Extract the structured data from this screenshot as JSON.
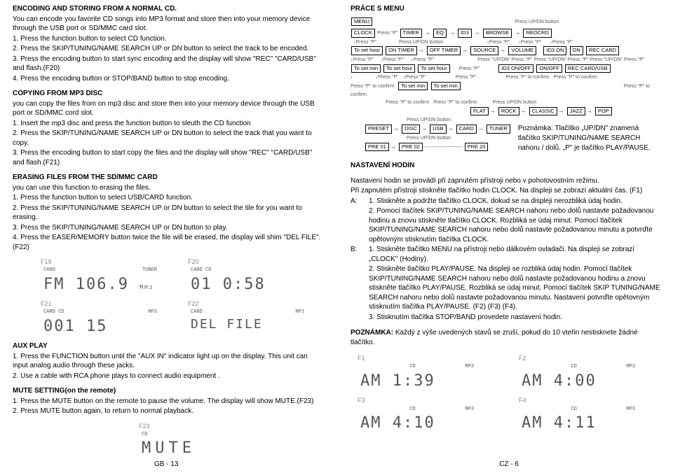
{
  "left": {
    "h1": "ENCODING AND STORING FROM A NORMAL CD.",
    "p1a": "You can encode you favorite CD songs into MP3 format and store then into your memory device through the USB port or SD/MMC card slot.",
    "p1b": "1. Press the function button to select CD function.",
    "p1c": "2. Press the SKIP/TUNING/NAME SEARCH UP or DN button to select the track to be encoded.",
    "p1d": "3. Press the encoding button to start sync encoding and the display will show \"REC\" \"CARD/USB\" and flash.(F20)",
    "p1e": "4. Press the encoding button or STOP/BAND button to stop encoding.",
    "h2": "COPYING FROM MP3 DISC",
    "p2a": "you can copy the files from on mp3 disc and store then into your memory device through the USB port or SD/MMC cord slot.",
    "p2b": "1. Insert the mp3 disc and press the function button to sleuth the CD function",
    "p2c": "2. Press the SKIP/TUNING/NAME SEARCH UP or DN button to select the track that you want to copy.",
    "p2d": "3. Press the encoding button to start copy the files and the display will show \"REC\" \"CARD/USB\" and flash.(F21)",
    "h3": "ERASING FILES FROM THE SD/MMC CARD",
    "p3a": "you can use this function to erasing the files.",
    "p3b": "1. Press the function button to select USB/CARD function.",
    "p3c": "2. Press the SKIP/TUNING/NAME SEARCH UP or DN button to select the tile for you want to erasing.",
    "p3d": "3. Press the SKIP/TUNING/NAME SEARCH UP or DN button to play.",
    "p3e": "4. Press the EASER/MEMORY button twice the file will be erased, the display will shim \"DEL FILE\".(F22)",
    "f19_label": "F19",
    "f20_label": "F20",
    "f21_label": "F21",
    "f22_label": "F22",
    "f23_label": "F23",
    "f19_top_l": "CARD",
    "f19_top_r": "TUNER",
    "f19_main_l": "FM",
    "f19_main_r": "106.9",
    "f19_unit": "MHz",
    "f20_top_l": "CARD  CD",
    "f20_main": "01   0:58",
    "f21_top_l": "CARD  CD",
    "f21_top_r": "MP3",
    "f21_main": "001      15",
    "f22_top_l": "CARD",
    "f22_top_r": "MP3",
    "f22_main": "DEL FILE",
    "h4": "AUX PLAY",
    "p4a": "1. Press the FUNCTION button until the \"AUX IN\" indicator light up on the display. This unit can input analog audio through these jacks.",
    "p4b": "2. Use a cable with RCA phone plays to connect audio equipment .",
    "h5": "MUTE SETTING(on the remote)",
    "p5a": "1. Press the MUTE button on the remote to pause the volume. The display will show MUTE.(F23)",
    "p5b": "2. Press MUTE button again, to return to normal playback.",
    "f23_top_l": "CD",
    "f23_main": "MUTE",
    "footer": "GB - 13"
  },
  "right": {
    "h1": "PRÁCE S MENU",
    "d": {
      "menu": "MENU",
      "clock": "CLOCK",
      "timer": "TIMER",
      "eq": "EQ",
      "id3": "ID3",
      "browse": "BROWSE",
      "reocrd": "REOCRD",
      "tosethour": "To set hour",
      "tosetmin": "To set min",
      "ontimer": "ON TIMER",
      "offtimer": "OFF TIMER",
      "source": "SOURCE",
      "volume": "VOLUME",
      "id3on": "ID3 ON",
      "on": "ON",
      "reccard": "REC CARD",
      "id3onoff": "ID3 ON/OFF",
      "onoff": "ON/OFF",
      "reccardusb": "REC CARD/USB",
      "flat": "FLAT",
      "rock": "ROCK",
      "classic": "CLASSIC",
      "jazz": "JAZZ",
      "pop": "POP",
      "preset": "PRESET",
      "disc": "DISC",
      "usb": "USB",
      "card": "CARD",
      "tuner": "TUNER",
      "pre01": "PRE 01",
      "pre02": "PRE 02",
      "pre20": "PRE 20",
      "pressp": "Press \"P\"",
      "pressupdn": "Press UP/DN button",
      "pressptoconfirm": "Press \"P\" to confirm",
      "pressupdnpressp": "Press \"UP/DN\" Press \"P\""
    },
    "note1": "Poznámka: Tlačítko „UP/DN\" znamená tlačítko SKIP/TUNING/NAME SEARCH nahoru / dolů. „P\" je tlačítko PLAY/PAUSE.",
    "h2": "NASTAVENÍ HODIN",
    "p2a": "Nastavení hodin se provádí při zapnutém přístroji nebo v pohotovostním režimu.",
    "p2b": "Při zapnutém přístroji stiskněte tlačítko hodin CLOCK. Na displeji se zobrazí aktuální čas. (F1)",
    "pA_lbl": "A:",
    "pA1": "1. Stiskněte a podržte tlačítko CLOCK, dokud se na displeji nerozbliká údaj hodin.",
    "pA2": "2. Pomocí tlačítek SKIP/TUNING/NAME SEARCH nahoru nebo dolů nastavte požadovanou hodinu a znovu stiskněte tlačítko CLOCK. Rozbliká se údaj minut. Pomocí tlačítek SKIP/TUNING/NAME SEARCH nahoru nebo dolů nastavte požadovanou minutu a potvrďte opětovným stisknutím tlačítka CLOCK.",
    "pB_lbl": "B:",
    "pB1": "1. Stiskněte tlačítko MENU na přístroji nebo dálkovém ovladači. Na displeji se zobrazí „CLOCK\" (Hodiny).",
    "pB2": "2. Stiskněte tlačítko PLAY/PAUSE. Na displeji se rozbliká údaj hodin. Pomocí tlačítek SKIP/TUNING/NAME SEARCH nahoru nebo dolů nastavte požadovanou hodinu a znovu stiskněte tlačítko PLAY/PAUSE. Rozbliká se údaj minut. Pomocí tlačítek SKIP TUNING/NAME SEARCH nahoru nebo dolů nastavte požadovanou minutu. Nastavení potvrďte opětovným stisknutím tlačítka PLAY/PAUSE. (F2) (F3) (F4).",
    "pB3": "3. Stisknutím tlačítka STOP/BAND provedete nastavení hodin.",
    "note2_lbl": "POZNÁMKA:",
    "note2": "Každý z výše uvedených stavů se zruší, pokud do 10 vteřin nestisknete žádné tlačítko.",
    "f1_label": "F1",
    "f2_label": "F2",
    "f3_label": "F3",
    "f4_label": "F4",
    "ftop_l": "CD",
    "ftop_r": "MP3",
    "f1_main": "AM    1:39",
    "f2_main": "AM    4:00",
    "f3_main": "AM    4:10",
    "f4_main": "AM    4:11",
    "footer": "CZ - 6"
  }
}
